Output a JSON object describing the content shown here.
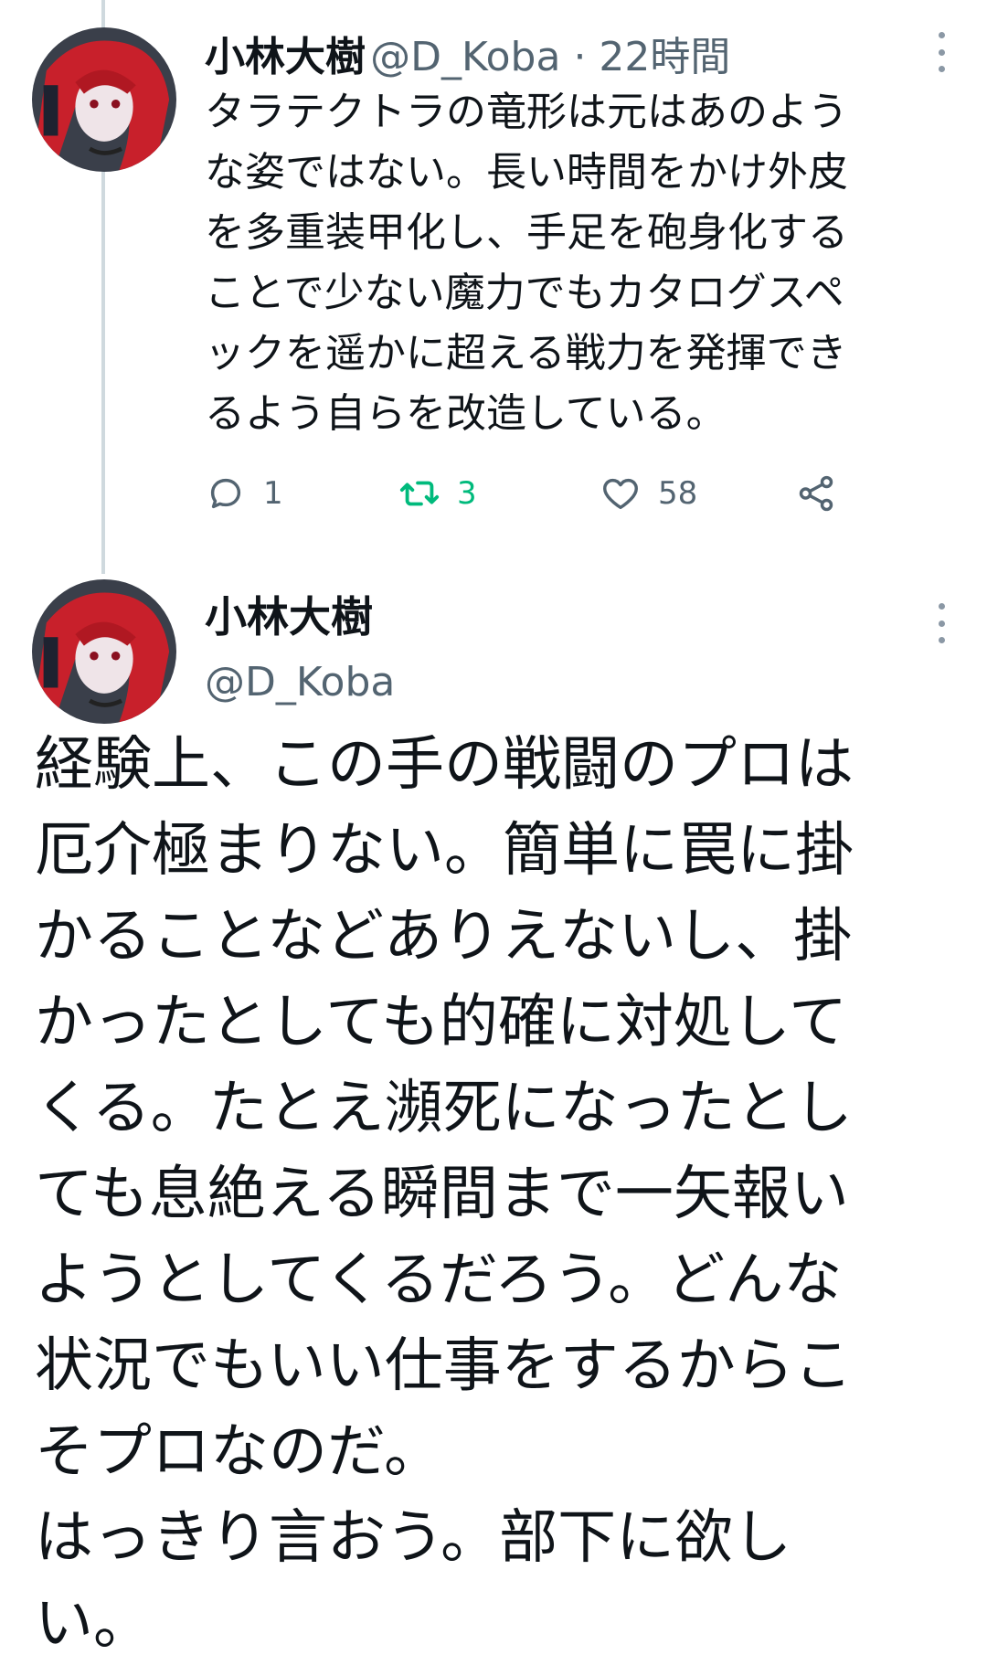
{
  "tweet1": {
    "name": "小林大樹",
    "handle": "@D_Koba",
    "separator": " · ",
    "time": "22時間",
    "lines": [
      "タラテクトラの竜形は元はあのよう",
      "な姿ではない。長い時間をかけ外皮",
      "を多重装甲化し、手足を砲身化する",
      "ことで少ない魔力でもカタログスペ",
      "ックを遥かに超える戦力を発揮でき",
      "るよう自らを改造している。"
    ],
    "actions": {
      "reply_count": "1",
      "retweet_count": "3",
      "like_count": "58"
    }
  },
  "tweet2": {
    "name": "小林大樹",
    "handle": "@D_Koba",
    "lines": [
      "経験上、この手の戦闘のプロは",
      "厄介極まりない。簡単に罠に掛",
      "かることなどありえないし、掛",
      "かったとしても的確に対処して",
      "くる。たとえ瀕死になったとし",
      "ても息絶える瞬間まで一矢報い",
      "ようとしてくるだろう。どんな",
      "状況でもいい仕事をするからこ",
      "そプロなのだ。",
      "はっきり言おう。部下に欲し",
      "い。"
    ]
  },
  "colors": {
    "retweet_active": "#00ba7c",
    "secondary_text": "#536471",
    "thread_line": "#cfd9de"
  },
  "icons": [
    "more-vertical-icon",
    "reply-icon",
    "retweet-icon",
    "like-icon",
    "share-icon"
  ]
}
